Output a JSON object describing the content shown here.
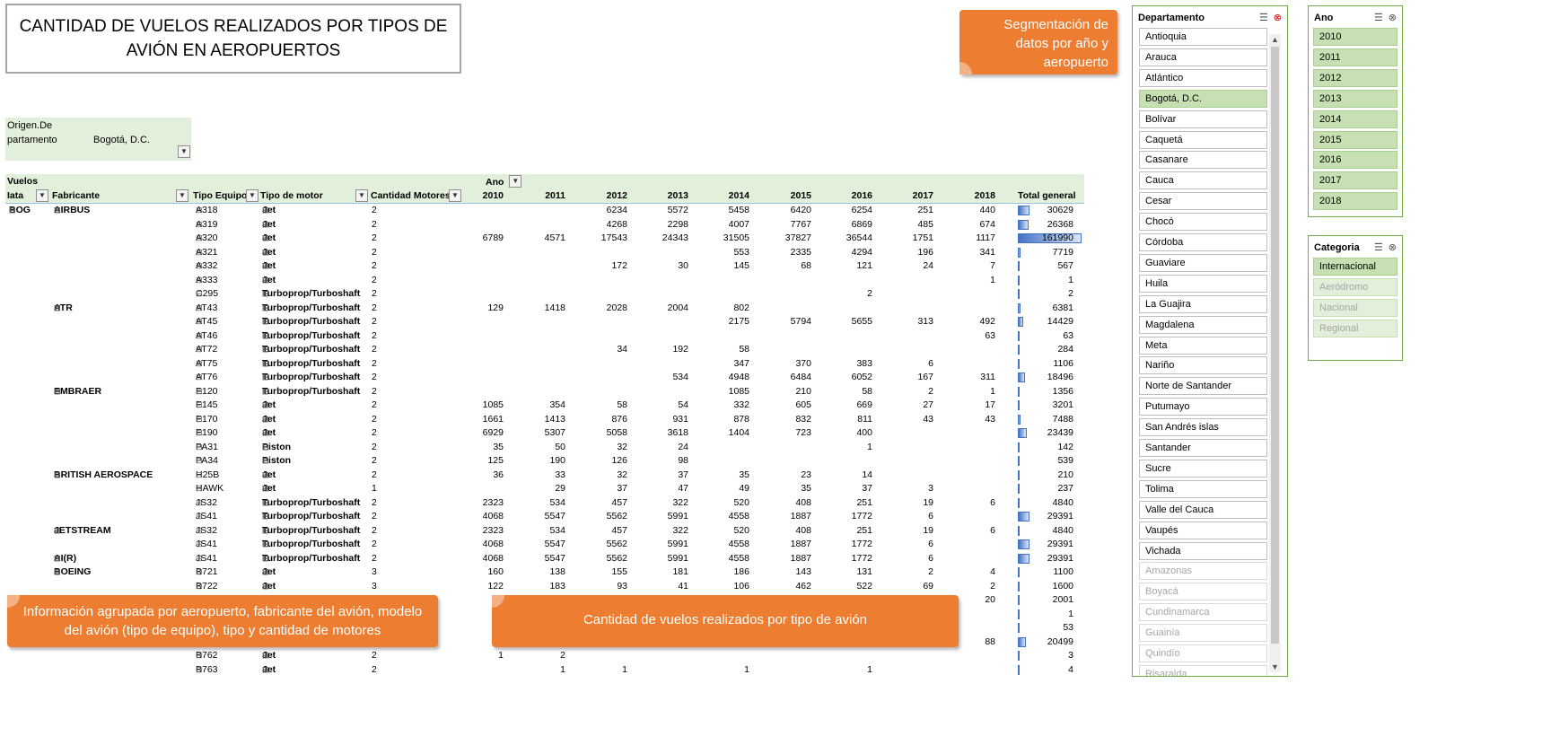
{
  "title": "CANTIDAD DE VUELOS REALIZADOS POR TIPOS DE AVIÓN EN AEROPUERTOS",
  "callouts": {
    "segmentation": "Segmentación de datos por año y aeropuerto",
    "grouping": "Información agrupada por aeropuerto, fabricante del avión, modelo del avión (tipo de equipo), tipo y cantidad de motores",
    "count": "Cantidad de vuelos realizados por tipo de avión"
  },
  "report_filter": {
    "label": "Origen.Departamento",
    "value": "Bogotá, D.C."
  },
  "pivot": {
    "values_label": "Vuelos",
    "column_field": "Ano",
    "row_headers": [
      "Iata",
      "Fabricante",
      "Tipo Equipo",
      "Tipo de motor",
      "Cantidad Motores"
    ],
    "years": [
      "2010",
      "2011",
      "2012",
      "2013",
      "2014",
      "2015",
      "2016",
      "2017",
      "2018"
    ],
    "total_label": "Total general",
    "max_total": 161990,
    "rows": [
      {
        "iata": "BOG",
        "fab": "AIRBUS",
        "eq": "A318",
        "motor": "Jet",
        "cant": "2",
        "v": [
          "",
          "",
          "6234",
          "5572",
          "5458",
          "6420",
          "6254",
          "251",
          "440"
        ],
        "total": "30629"
      },
      {
        "iata": "",
        "fab": "",
        "eq": "A319",
        "motor": "Jet",
        "cant": "2",
        "v": [
          "",
          "",
          "4268",
          "2298",
          "4007",
          "7767",
          "6869",
          "485",
          "674"
        ],
        "total": "26368"
      },
      {
        "iata": "",
        "fab": "",
        "eq": "A320",
        "motor": "Jet",
        "cant": "2",
        "v": [
          "6789",
          "4571",
          "17543",
          "24343",
          "31505",
          "37827",
          "36544",
          "1751",
          "1117"
        ],
        "total": "161990"
      },
      {
        "iata": "",
        "fab": "",
        "eq": "A321",
        "motor": "Jet",
        "cant": "2",
        "v": [
          "",
          "",
          "",
          "",
          "553",
          "2335",
          "4294",
          "196",
          "341"
        ],
        "total": "7719"
      },
      {
        "iata": "",
        "fab": "",
        "eq": "A332",
        "motor": "Jet",
        "cant": "2",
        "v": [
          "",
          "",
          "172",
          "30",
          "145",
          "68",
          "121",
          "24",
          "7"
        ],
        "total": "567"
      },
      {
        "iata": "",
        "fab": "",
        "eq": "A333",
        "motor": "Jet",
        "cant": "2",
        "v": [
          "",
          "",
          "",
          "",
          "",
          "",
          "",
          "",
          "1"
        ],
        "total": "1"
      },
      {
        "iata": "",
        "fab": "",
        "eq": "C295",
        "motor": "Turboprop/Turboshaft",
        "cant": "2",
        "v": [
          "",
          "",
          "",
          "",
          "",
          "",
          "2",
          "",
          ""
        ],
        "total": "2"
      },
      {
        "iata": "",
        "fab": "ATR",
        "eq": "AT43",
        "motor": "Turboprop/Turboshaft",
        "cant": "2",
        "v": [
          "129",
          "1418",
          "2028",
          "2004",
          "802",
          "",
          "",
          "",
          ""
        ],
        "total": "6381"
      },
      {
        "iata": "",
        "fab": "",
        "eq": "AT45",
        "motor": "Turboprop/Turboshaft",
        "cant": "2",
        "v": [
          "",
          "",
          "",
          "",
          "2175",
          "5794",
          "5655",
          "313",
          "492"
        ],
        "total": "14429"
      },
      {
        "iata": "",
        "fab": "",
        "eq": "AT46",
        "motor": "Turboprop/Turboshaft",
        "cant": "2",
        "v": [
          "",
          "",
          "",
          "",
          "",
          "",
          "",
          "",
          "63"
        ],
        "total": "63"
      },
      {
        "iata": "",
        "fab": "",
        "eq": "AT72",
        "motor": "Turboprop/Turboshaft",
        "cant": "2",
        "v": [
          "",
          "",
          "34",
          "192",
          "58",
          "",
          "",
          "",
          ""
        ],
        "total": "284"
      },
      {
        "iata": "",
        "fab": "",
        "eq": "AT75",
        "motor": "Turboprop/Turboshaft",
        "cant": "2",
        "v": [
          "",
          "",
          "",
          "",
          "347",
          "370",
          "383",
          "6",
          ""
        ],
        "total": "1106"
      },
      {
        "iata": "",
        "fab": "",
        "eq": "AT76",
        "motor": "Turboprop/Turboshaft",
        "cant": "2",
        "v": [
          "",
          "",
          "",
          "534",
          "4948",
          "6484",
          "6052",
          "167",
          "311"
        ],
        "total": "18496"
      },
      {
        "iata": "",
        "fab": "EMBRAER",
        "eq": "E120",
        "motor": "Turboprop/Turboshaft",
        "cant": "2",
        "v": [
          "",
          "",
          "",
          "",
          "1085",
          "210",
          "58",
          "2",
          "1"
        ],
        "total": "1356"
      },
      {
        "iata": "",
        "fab": "",
        "eq": "E145",
        "motor": "Jet",
        "cant": "2",
        "v": [
          "1085",
          "354",
          "58",
          "54",
          "332",
          "605",
          "669",
          "27",
          "17"
        ],
        "total": "3201"
      },
      {
        "iata": "",
        "fab": "",
        "eq": "E170",
        "motor": "Jet",
        "cant": "2",
        "v": [
          "1661",
          "1413",
          "876",
          "931",
          "878",
          "832",
          "811",
          "43",
          "43"
        ],
        "total": "7488"
      },
      {
        "iata": "",
        "fab": "",
        "eq": "E190",
        "motor": "Jet",
        "cant": "2",
        "v": [
          "6929",
          "5307",
          "5058",
          "3618",
          "1404",
          "723",
          "400",
          "",
          ""
        ],
        "total": "23439"
      },
      {
        "iata": "",
        "fab": "",
        "eq": "PA31",
        "motor": "Piston",
        "cant": "2",
        "v": [
          "35",
          "50",
          "32",
          "24",
          "",
          "",
          "1",
          "",
          ""
        ],
        "total": "142"
      },
      {
        "iata": "",
        "fab": "",
        "eq": "PA34",
        "motor": "Piston",
        "cant": "2",
        "v": [
          "125",
          "190",
          "126",
          "98",
          "",
          "",
          "",
          "",
          ""
        ],
        "total": "539"
      },
      {
        "iata": "",
        "fab": "BRITISH AEROSPACE",
        "eq": "H25B",
        "motor": "Jet",
        "cant": "2",
        "v": [
          "36",
          "33",
          "32",
          "37",
          "35",
          "23",
          "14",
          "",
          ""
        ],
        "total": "210"
      },
      {
        "iata": "",
        "fab": "",
        "eq": "HAWK",
        "motor": "Jet",
        "cant": "1",
        "v": [
          "",
          "29",
          "37",
          "47",
          "49",
          "35",
          "37",
          "3",
          ""
        ],
        "total": "237"
      },
      {
        "iata": "",
        "fab": "",
        "eq": "JS32",
        "motor": "Turboprop/Turboshaft",
        "cant": "2",
        "v": [
          "2323",
          "534",
          "457",
          "322",
          "520",
          "408",
          "251",
          "19",
          "6"
        ],
        "total": "4840"
      },
      {
        "iata": "",
        "fab": "",
        "eq": "JS41",
        "motor": "Turboprop/Turboshaft",
        "cant": "2",
        "v": [
          "4068",
          "5547",
          "5562",
          "5991",
          "4558",
          "1887",
          "1772",
          "6",
          ""
        ],
        "total": "29391"
      },
      {
        "iata": "",
        "fab": "JETSTREAM",
        "eq": "JS32",
        "motor": "Turboprop/Turboshaft",
        "cant": "2",
        "v": [
          "2323",
          "534",
          "457",
          "322",
          "520",
          "408",
          "251",
          "19",
          "6"
        ],
        "total": "4840"
      },
      {
        "iata": "",
        "fab": "",
        "eq": "JS41",
        "motor": "Turboprop/Turboshaft",
        "cant": "2",
        "v": [
          "4068",
          "5547",
          "5562",
          "5991",
          "4558",
          "1887",
          "1772",
          "6",
          ""
        ],
        "total": "29391"
      },
      {
        "iata": "",
        "fab": "AI(R)",
        "eq": "JS41",
        "motor": "Turboprop/Turboshaft",
        "cant": "2",
        "v": [
          "4068",
          "5547",
          "5562",
          "5991",
          "4558",
          "1887",
          "1772",
          "6",
          ""
        ],
        "total": "29391"
      },
      {
        "iata": "",
        "fab": "BOEING",
        "eq": "B721",
        "motor": "Jet",
        "cant": "3",
        "v": [
          "160",
          "138",
          "155",
          "181",
          "186",
          "143",
          "131",
          "2",
          "4"
        ],
        "total": "1100"
      },
      {
        "iata": "",
        "fab": "",
        "eq": "B722",
        "motor": "Jet",
        "cant": "3",
        "v": [
          "122",
          "183",
          "93",
          "41",
          "106",
          "462",
          "522",
          "69",
          "2"
        ],
        "total": "1600"
      },
      {
        "iata": "",
        "fab": "",
        "eq": "",
        "motor": "",
        "cant": "",
        "v": [
          "2",
          "",
          "",
          "",
          "",
          "",
          "",
          "",
          "20"
        ],
        "total": "2001"
      },
      {
        "iata": "",
        "fab": "",
        "eq": "",
        "motor": "",
        "cant": "",
        "v": [
          "",
          "",
          "",
          "",
          "",
          "",
          "",
          "",
          ""
        ],
        "total": "1"
      },
      {
        "iata": "",
        "fab": "",
        "eq": "",
        "motor": "",
        "cant": "",
        "v": [
          "",
          "",
          "",
          "",
          "",
          "",
          "",
          "",
          ""
        ],
        "total": "53"
      },
      {
        "iata": "",
        "fab": "",
        "eq": "",
        "motor": "",
        "cant": "",
        "v": [
          "53",
          "",
          "",
          "",
          "",
          "",
          "",
          "",
          "88"
        ],
        "total": "20499"
      },
      {
        "iata": "",
        "fab": "",
        "eq": "B762",
        "motor": "Jet",
        "cant": "2",
        "v": [
          "1",
          "2",
          "",
          "",
          "",
          "",
          "",
          "",
          ""
        ],
        "total": "3"
      },
      {
        "iata": "",
        "fab": "",
        "eq": "B763",
        "motor": "Jet",
        "cant": "2",
        "v": [
          "",
          "1",
          "1",
          "",
          "1",
          "",
          "1",
          "",
          ""
        ],
        "total": "4"
      }
    ]
  },
  "slicers": {
    "departamento": {
      "header": "Departamento",
      "items": [
        {
          "label": "Antioquia",
          "state": "normal"
        },
        {
          "label": "Arauca",
          "state": "normal"
        },
        {
          "label": "Atlántico",
          "state": "normal"
        },
        {
          "label": "Bogotá, D.C.",
          "state": "selected"
        },
        {
          "label": "Bolívar",
          "state": "normal"
        },
        {
          "label": "Caquetá",
          "state": "normal"
        },
        {
          "label": "Casanare",
          "state": "normal"
        },
        {
          "label": "Cauca",
          "state": "normal"
        },
        {
          "label": "Cesar",
          "state": "normal"
        },
        {
          "label": "Chocó",
          "state": "normal"
        },
        {
          "label": "Córdoba",
          "state": "normal"
        },
        {
          "label": "Guaviare",
          "state": "normal"
        },
        {
          "label": "Huila",
          "state": "normal"
        },
        {
          "label": "La Guajira",
          "state": "normal"
        },
        {
          "label": "Magdalena",
          "state": "normal"
        },
        {
          "label": "Meta",
          "state": "normal"
        },
        {
          "label": "Nariño",
          "state": "normal"
        },
        {
          "label": "Norte de Santander",
          "state": "normal"
        },
        {
          "label": "Putumayo",
          "state": "normal"
        },
        {
          "label": "San Andrés islas",
          "state": "normal"
        },
        {
          "label": "Santander",
          "state": "normal"
        },
        {
          "label": "Sucre",
          "state": "normal"
        },
        {
          "label": "Tolima",
          "state": "normal"
        },
        {
          "label": "Valle del Cauca",
          "state": "normal"
        },
        {
          "label": "Vaupés",
          "state": "normal"
        },
        {
          "label": "Vichada",
          "state": "normal"
        },
        {
          "label": "Amazonas",
          "state": "disabled"
        },
        {
          "label": "Boyacá",
          "state": "disabled"
        },
        {
          "label": "Cundinamarca",
          "state": "disabled"
        },
        {
          "label": "Guainía",
          "state": "disabled"
        },
        {
          "label": "Quindío",
          "state": "disabled"
        },
        {
          "label": "Risaralda",
          "state": "disabled"
        }
      ]
    },
    "ano": {
      "header": "Ano",
      "items": [
        {
          "label": "2010",
          "state": "selected"
        },
        {
          "label": "2011",
          "state": "selected"
        },
        {
          "label": "2012",
          "state": "selected"
        },
        {
          "label": "2013",
          "state": "selected"
        },
        {
          "label": "2014",
          "state": "selected"
        },
        {
          "label": "2015",
          "state": "selected"
        },
        {
          "label": "2016",
          "state": "selected"
        },
        {
          "label": "2017",
          "state": "selected"
        },
        {
          "label": "2018",
          "state": "selected"
        }
      ]
    },
    "categoria": {
      "header": "Categoria",
      "items": [
        {
          "label": "Internacional",
          "state": "selected"
        },
        {
          "label": "Aeródromo",
          "state": "seldis"
        },
        {
          "label": "Nacional",
          "state": "seldis"
        },
        {
          "label": "Regional",
          "state": "seldis"
        }
      ]
    }
  },
  "colors": {
    "accent_orange": "#ed7d31",
    "header_green": "#e2efda",
    "slicer_selected": "#c6e0b4",
    "slicer_border": "#70ad47",
    "databar_blue": "#4472c4"
  }
}
